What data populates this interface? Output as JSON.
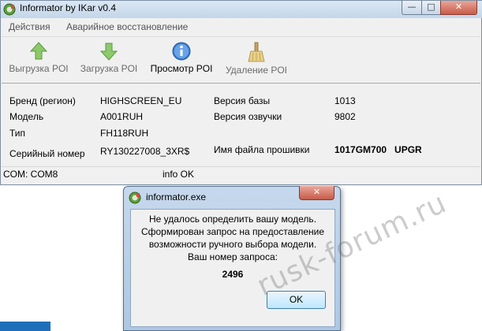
{
  "window": {
    "title": "Informator by IKar v0.4",
    "min_glyph": "—",
    "max_glyph": "□",
    "close_glyph": "✕"
  },
  "menu": {
    "items": [
      "Действия",
      "Аварийное восстановление"
    ]
  },
  "toolbar": {
    "buttons": [
      {
        "label": "Выгрузка POI",
        "icon": "arrow-up-green-icon"
      },
      {
        "label": "Загрузка POI",
        "icon": "arrow-down-green-icon"
      },
      {
        "label": "Просмотр POI",
        "icon": "info-blue-icon",
        "active": true
      },
      {
        "label": "Удаление POI",
        "icon": "broom-icon"
      }
    ]
  },
  "info": {
    "brand_label": "Бренд (регион)",
    "brand_value": "HIGHSCREEN_EU",
    "model_label": "Модель",
    "model_value": "A001RUH",
    "type_label": "Тип",
    "type_value": "FH118RUH",
    "serial_label": "Серийный номер",
    "serial_value": "RY130227008_3XR$",
    "db_version_label": "Версия базы",
    "db_version_value": "1013",
    "voice_version_label": "Версия озвучки",
    "voice_version_value": "9802",
    "firmware_label": "Имя файла прошивки",
    "firmware_value": "1017GM700   UPGR"
  },
  "status": {
    "port": "COM: COM8",
    "info": "info OK"
  },
  "dialog": {
    "title": "informator.exe",
    "close_glyph": "✕",
    "message_lines": [
      "Не удалось определить вашу модель.",
      "Сформирован запрос на предоставление",
      "возможности ручного выбора модели.",
      "Ваш номер запроса:"
    ],
    "request_number": "2496",
    "ok_label": "OK"
  },
  "watermark": "rusk-forum.ru",
  "colors": {
    "titlebar": "#c3d6ea",
    "close_button": "#c95b48",
    "ok_button": "#bee6fd",
    "window_bg": "#f0f0f0"
  }
}
